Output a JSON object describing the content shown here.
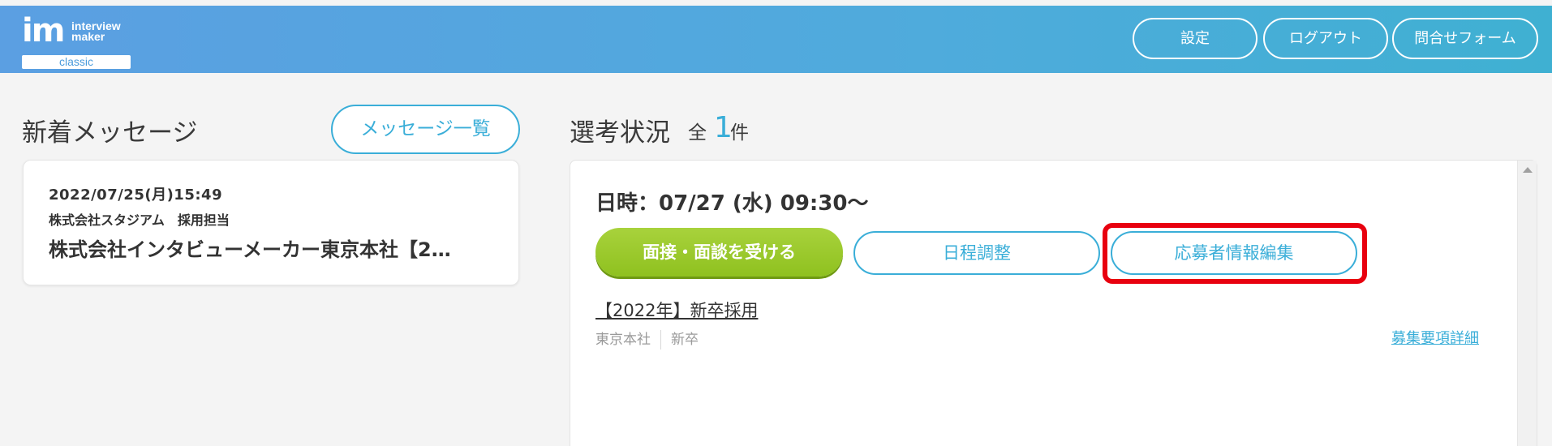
{
  "header": {
    "logo": {
      "mark": "im",
      "line1": "interview",
      "line2": "maker",
      "badge": "classic"
    },
    "buttons": {
      "settings": "設定",
      "logout": "ログアウト",
      "contact": "問合せフォーム"
    }
  },
  "messages": {
    "title": "新着メッセージ",
    "list_button": "メッセージ一覧",
    "items": [
      {
        "date": "2022/07/25(月)15:49",
        "sender": "株式会社スタジアム　採用担当",
        "subject": "株式会社インタビューメーカー東京本社【2…"
      }
    ]
  },
  "status": {
    "title": "選考状況",
    "total_label": "全",
    "total_count": "1",
    "unit": "件",
    "card": {
      "datetime": "日時：07/27 (水) 09:30〜",
      "interview_button": "面接・面談を受ける",
      "schedule_button": "日程調整",
      "edit_button": "応募者情報編集",
      "job_title": "【2022年】新卒採用",
      "location": "東京本社",
      "category": "新卒",
      "detail_link": "募集要項詳細"
    }
  },
  "colors": {
    "accent": "#3aaed8",
    "primary_green": "#8fc11f",
    "highlight": "#e8000f"
  }
}
